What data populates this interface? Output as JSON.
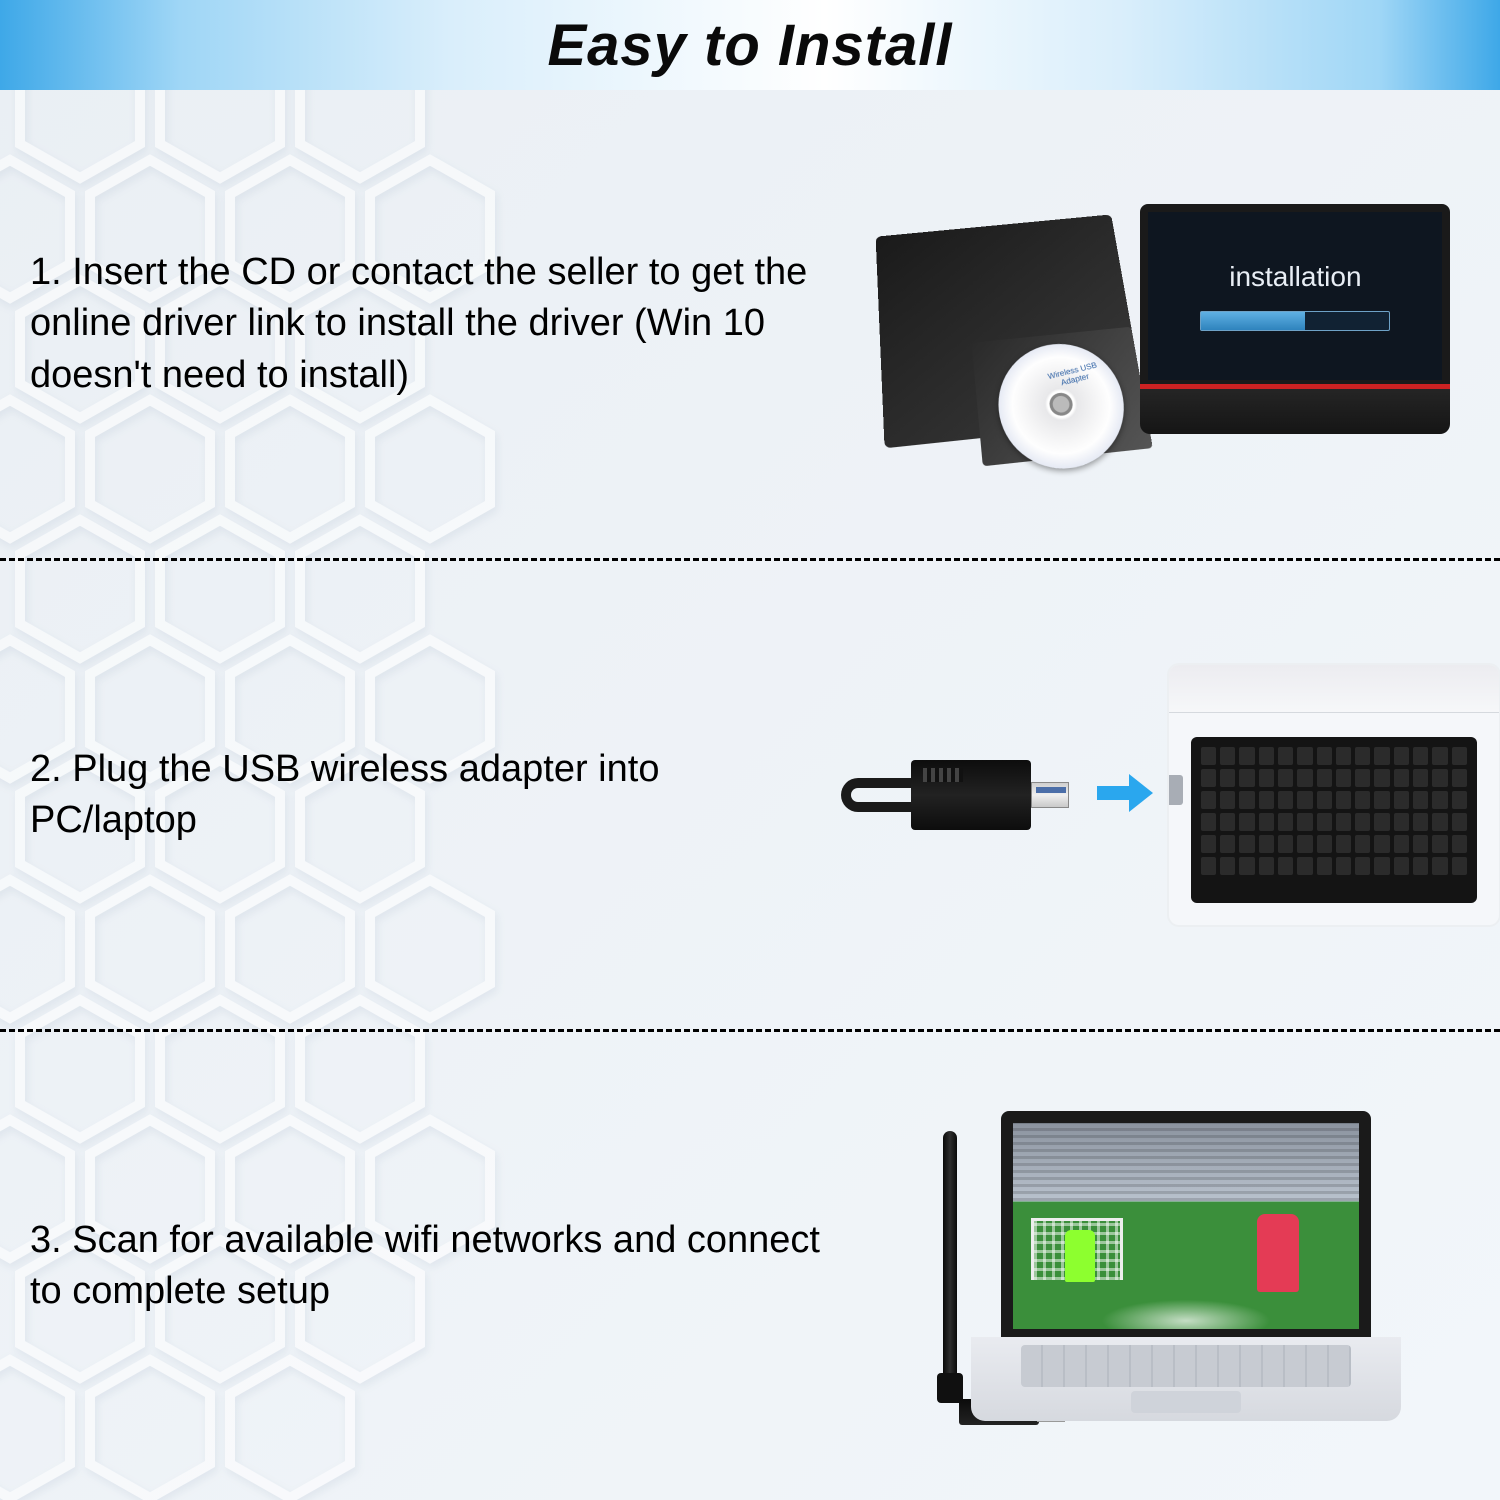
{
  "header": {
    "title": "Easy to Install"
  },
  "steps": [
    {
      "text": "1. Insert the CD or contact the seller to get the online driver link to install the driver (Win 10 doesn't need to install)",
      "image": {
        "screen_label": "installation",
        "cd_label": "Wireless USB Adapter"
      }
    },
    {
      "text": "2. Plug the USB wireless adapter into PC/laptop"
    },
    {
      "text": "3. Scan for available wifi networks and connect to complete setup"
    }
  ]
}
